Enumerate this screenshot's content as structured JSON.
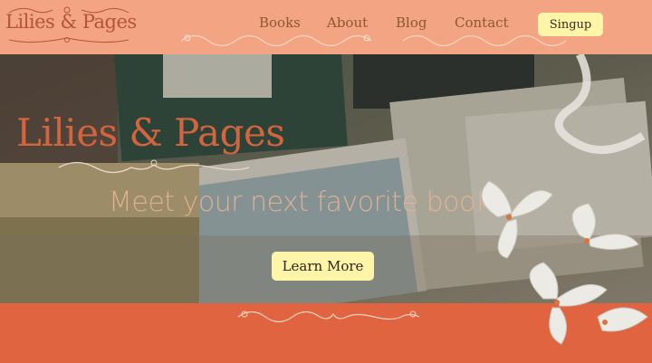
{
  "brand": {
    "logo_text": "Lilies & Pages"
  },
  "nav": {
    "items": [
      {
        "label": "Books"
      },
      {
        "label": "About"
      },
      {
        "label": "Blog"
      },
      {
        "label": "Contact"
      }
    ],
    "signup_label": "Singup"
  },
  "hero": {
    "title": "Lilies & Pages",
    "tagline": "Meet your next favorite book....",
    "cta_label": "Learn More"
  },
  "colors": {
    "nav_bg": "#f3a482",
    "accent": "#d2643e",
    "footer_bg": "#e0643f",
    "button_bg": "#fff5a8"
  }
}
